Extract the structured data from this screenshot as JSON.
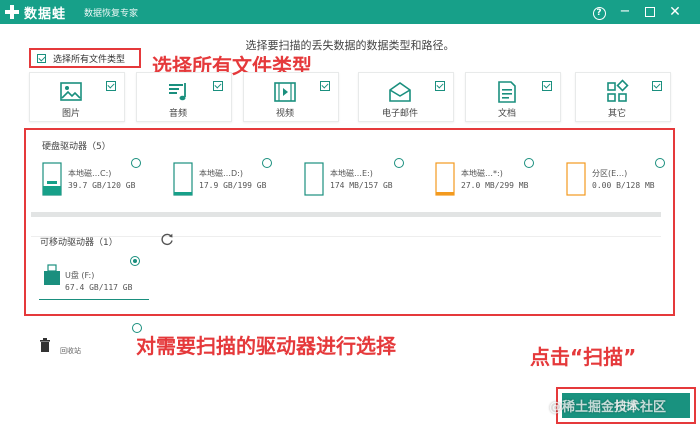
{
  "titlebar": {
    "app_name": "数据蛙",
    "subtitle": "数据恢复专家",
    "help": "?",
    "minimize": "−",
    "close": "✕",
    "accent": "#17a089"
  },
  "instruction": "选择要扫描的丢失数据的数据类型和路径。",
  "select_all": {
    "label": "选择所有文件类型",
    "checked": true
  },
  "file_types": [
    {
      "label": "图片",
      "icon": "image-icon",
      "checked": true
    },
    {
      "label": "音频",
      "icon": "music-icon",
      "checked": true
    },
    {
      "label": "视频",
      "icon": "video-icon",
      "checked": true
    },
    {
      "label": "电子邮件",
      "icon": "email-icon",
      "checked": true
    },
    {
      "label": "文档",
      "icon": "document-icon",
      "checked": true
    },
    {
      "label": "其它",
      "icon": "other-icon",
      "checked": true
    }
  ],
  "hdd_section": {
    "title": "硬盘驱动器（5）"
  },
  "drives": [
    {
      "name": "本地磁…C:)",
      "size": "39.7 GB/120 GB",
      "usage": 0.33,
      "color": "#17a089"
    },
    {
      "name": "本地磁…D:)",
      "size": "17.9 GB/199 GB",
      "usage": 0.09,
      "color": "#17a089"
    },
    {
      "name": "本地磁…E:)",
      "size": "174 MB/157 GB",
      "usage": 0.0,
      "color": "#17a089"
    },
    {
      "name": "本地磁…*:)",
      "size": "27.0 MB/299 MB",
      "usage": 0.09,
      "color": "#f39a1e"
    },
    {
      "name": "分区(E…)",
      "size": "0.00  B/128 MB",
      "usage": 0.0,
      "color": "#f39a1e"
    }
  ],
  "removable_section": {
    "title": "可移动驱动器（1）"
  },
  "usb": {
    "name": "U盘 (F:)",
    "size": "67.4 GB/117 GB",
    "selected": true
  },
  "recycle": {
    "label": "回收站"
  },
  "scan_button": {
    "label": "扫描"
  },
  "annotations": {
    "select_all": "选择所有文件类型",
    "drives": "对需要扫描的驱动器进行选择",
    "scan": "点击“扫描”"
  },
  "watermark": "@稀土掘金技术社区"
}
